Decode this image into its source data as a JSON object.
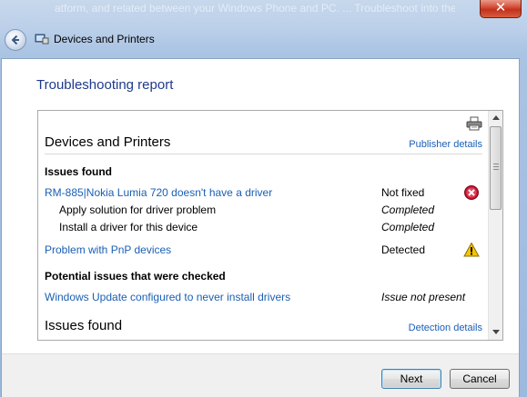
{
  "background_text": "atform, and related between your Windows Phone and PC. ... Troubleshoot into the with the phone",
  "window": {
    "title": "Devices and Printers",
    "close_glyph": "✕"
  },
  "page": {
    "heading": "Troubleshooting report"
  },
  "report": {
    "section1": {
      "title": "Devices and Printers",
      "link": "Publisher details",
      "issues_heading": "Issues found",
      "issues": [
        {
          "name": "RM-885|Nokia Lumia 720 doesn't have a driver",
          "status": "Not fixed",
          "icon": "error-icon"
        },
        {
          "name": "Apply solution for driver problem",
          "status": "Completed"
        },
        {
          "name": "Install a driver for this device",
          "status": "Completed"
        },
        {
          "name": "Problem with PnP devices",
          "status": "Detected",
          "icon": "warning-icon"
        }
      ],
      "potential_heading": "Potential issues that were checked",
      "potential": [
        {
          "name": "Windows Update configured to never install drivers",
          "status": "Issue not present"
        }
      ]
    },
    "section2": {
      "title": "Issues found",
      "link": "Detection details"
    }
  },
  "buttons": {
    "next": "Next",
    "cancel": "Cancel"
  },
  "colors": {
    "link": "#1a5fb4",
    "heading": "#1e3a8a",
    "error": "#c8102e",
    "warning": "#f5c400"
  }
}
